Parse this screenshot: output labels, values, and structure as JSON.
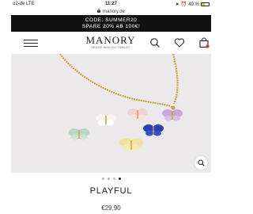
{
  "status": {
    "carrier": "o2-de  LTE",
    "time": "11:27",
    "battery": "49 %",
    "battery_level": 0.49
  },
  "browser": {
    "url": "manory.de"
  },
  "promo": {
    "line1": "CODE: SUMMER20",
    "line2": "SPARE 20% AB 100€!"
  },
  "header": {
    "logo": "MANORY",
    "tagline": "TRAGE WAS DU FÜHLST",
    "icons": [
      "menu-icon",
      "search-icon",
      "heart-icon",
      "bag-icon"
    ]
  },
  "colors": {
    "promo_bg": "#111111",
    "accent": "#e0322b",
    "background": "#ffffff"
  },
  "gallery": {
    "total_images": 4,
    "active_index": 3
  },
  "product": {
    "name": "PLAYFUL",
    "price": "€29,90"
  }
}
